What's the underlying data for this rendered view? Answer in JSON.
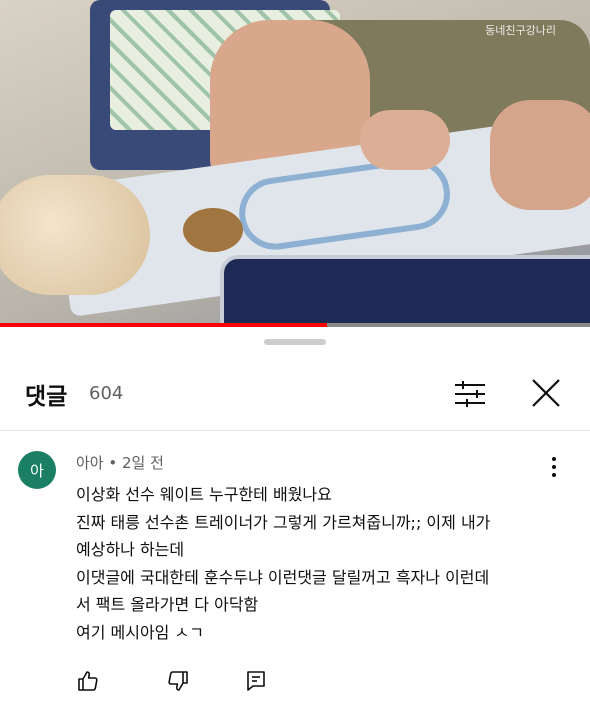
{
  "video": {
    "watermark": "동네친구강나리",
    "progress_fraction": 0.555
  },
  "comments_panel": {
    "title": "댓글",
    "count": "604",
    "filter_icon": "sort-filter-icon",
    "close_icon": "close-icon"
  },
  "comment": {
    "avatar_text": "아",
    "avatar_color": "#1a7f63",
    "meta": "아아 • 2일 전",
    "lines": [
      "이상화 선수 웨이트 누구한테 배웠나요",
      "진짜 태릉 선수촌 트레이너가 그렇게 가르쳐줍니까;; 이제 내가",
      "예상하나 하는데",
      "이댓글에 국대한테 훈수두냐 이런댓글 달릴꺼고 흑자나 이런데",
      "서 팩트 올라가면 다 아닥함",
      "여기 메시아임 ㅅㄱ"
    ],
    "actions": [
      "thumb-up-icon",
      "thumb-down-icon",
      "reply-icon"
    ]
  }
}
